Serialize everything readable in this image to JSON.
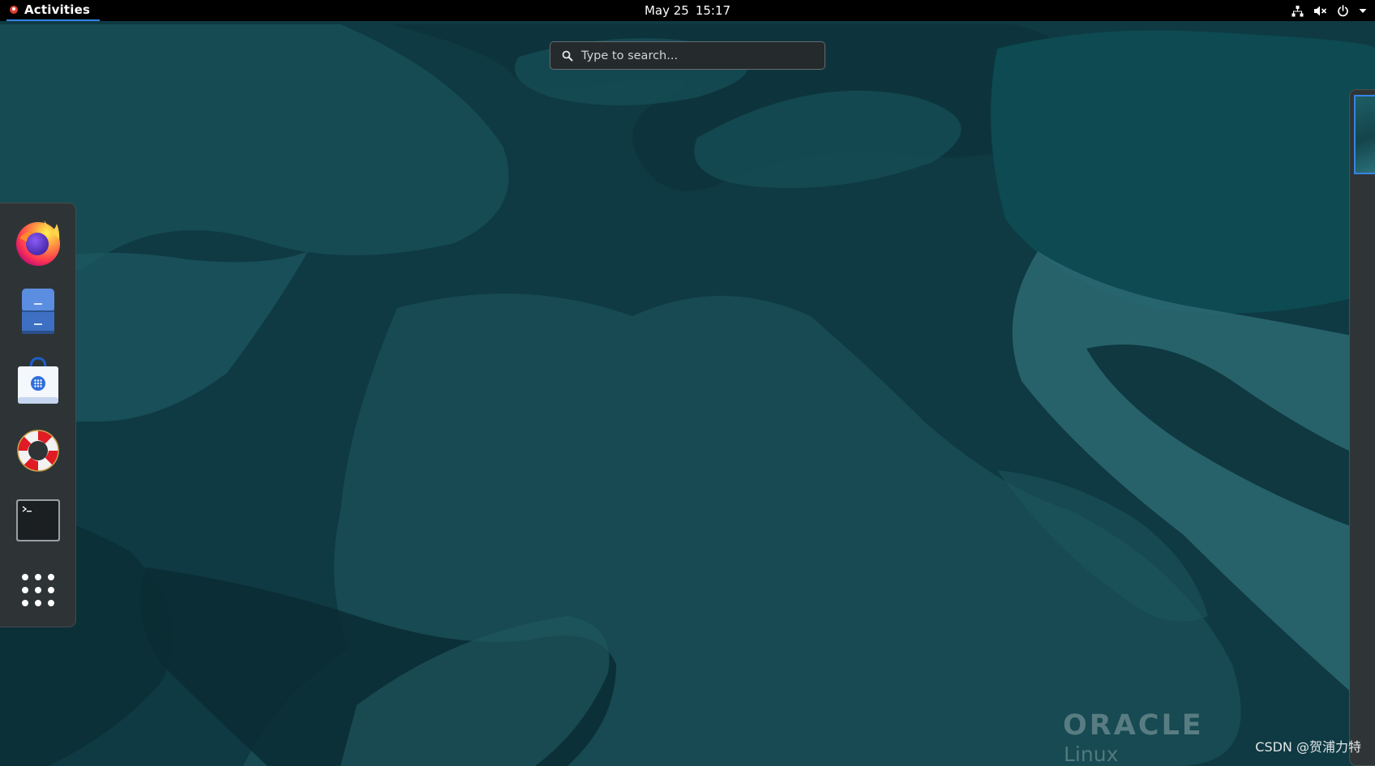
{
  "top_bar": {
    "activities_label": "Activities",
    "date": "May 25",
    "time": "15:17",
    "tray_icons": [
      "network-icon",
      "volume-muted-icon",
      "power-icon",
      "caret-down-icon"
    ]
  },
  "search": {
    "placeholder": "Type to search..."
  },
  "dash": {
    "items": [
      {
        "name": "firefox-icon",
        "app": "Firefox"
      },
      {
        "name": "files-icon",
        "app": "Files"
      },
      {
        "name": "software-icon",
        "app": "Software"
      },
      {
        "name": "help-icon",
        "app": "Help"
      },
      {
        "name": "terminal-icon",
        "app": "Terminal"
      },
      {
        "name": "show-applications-icon",
        "app": "Show Applications"
      }
    ]
  },
  "watermark": {
    "brand": "ORACLE",
    "product": "Linux",
    "credit": "CSDN @贺浦力特"
  },
  "colors": {
    "top_bar": "#000000",
    "accent": "#3584e4",
    "dash_bg": "#2e3436",
    "wallpaper_base": "#0f3a43"
  }
}
